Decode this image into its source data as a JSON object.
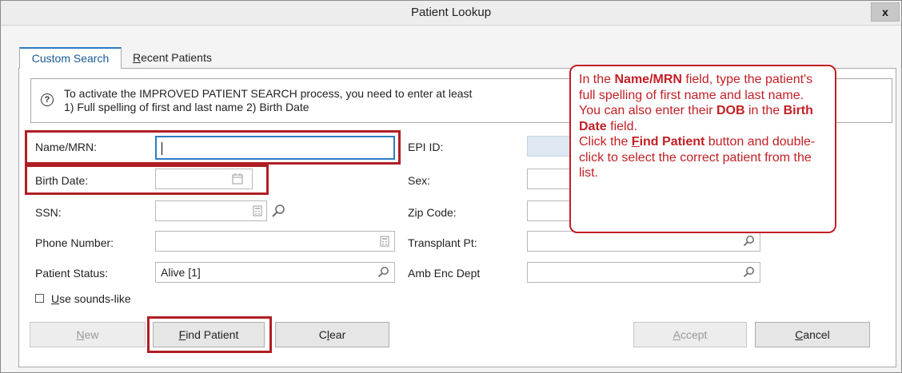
{
  "window": {
    "title": "Patient Lookup",
    "close_glyph": "x"
  },
  "tabs": [
    {
      "label": "Custom Search",
      "active": true
    },
    {
      "label": "Recent Patients",
      "active": false
    }
  ],
  "info": {
    "line1": "To activate the IMPROVED PATIENT SEARCH process, you need to enter at least",
    "line2": "1) Full spelling of first and last name 2) Birth Date"
  },
  "fields": {
    "name_mrn": {
      "label": "Name/MRN:",
      "value": ""
    },
    "birth_date": {
      "label": "Birth Date:",
      "value": ""
    },
    "ssn": {
      "label": "SSN:",
      "value": ""
    },
    "phone": {
      "label": "Phone Number:",
      "value": ""
    },
    "patient_status": {
      "label": "Patient Status:",
      "value": "Alive [1]"
    },
    "epi_id": {
      "label": "EPI ID:",
      "value": ""
    },
    "sex": {
      "label": "Sex:",
      "value": ""
    },
    "zip": {
      "label": "Zip Code:",
      "value": ""
    },
    "transplant": {
      "label": "Transplant Pt:",
      "value": ""
    },
    "amb_enc": {
      "label": "Amb Enc Dept",
      "value": ""
    }
  },
  "sounds_like": {
    "label": "Use sounds-like",
    "checked": false
  },
  "buttons": {
    "new": "New",
    "find_patient": "Find Patient",
    "clear": "Clear",
    "accept": "Accept",
    "cancel": "Cancel"
  },
  "callout": {
    "t1": "In the ",
    "b1": "Name/MRN",
    "t2": " field, type the patient's full spelling of first name and last name.",
    "t3": "You can also enter their ",
    "b2": "DOB",
    "t4": " in the ",
    "b3": "Birth Date",
    "t5": " field.",
    "t6": "Click the ",
    "b4u": "F",
    "b4": "ind Patient",
    "t7": " button and double-click to select the correct patient from the list."
  },
  "colors": {
    "accent": "#2e7bc4",
    "annotation": "#c21f24",
    "focus_border": "#2e7bc4"
  }
}
